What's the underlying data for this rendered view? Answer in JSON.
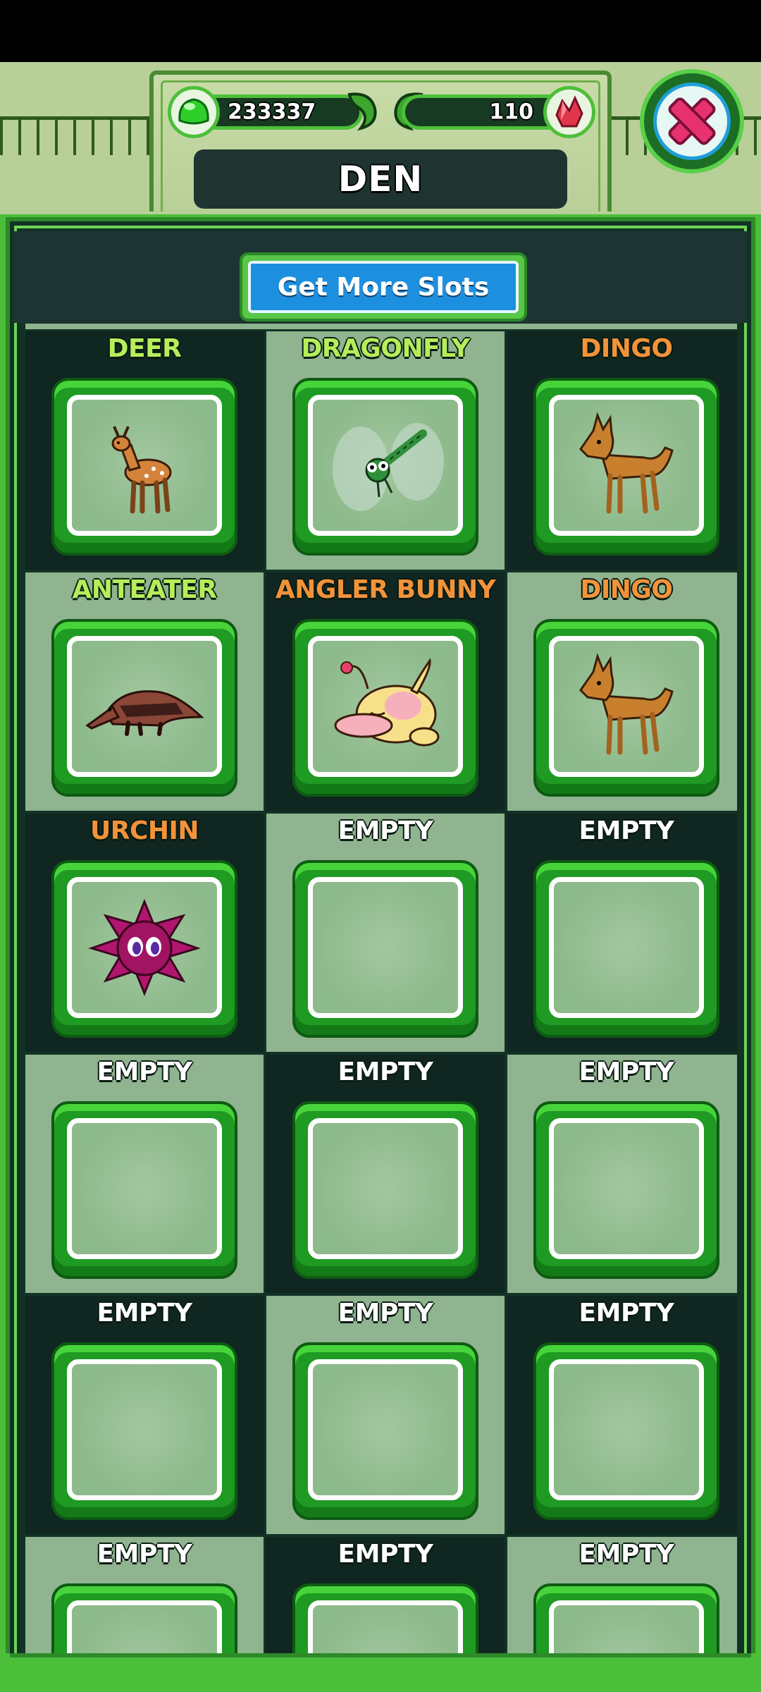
{
  "header": {
    "gel_count": "233337",
    "gem_count": "110",
    "title": "DEN"
  },
  "panel": {
    "more_slots_label": "Get More Slots"
  },
  "colors": {
    "name_green": "#b6ee5a",
    "name_orange": "#f2933a",
    "name_white": "#ffffff"
  },
  "slots": [
    {
      "name": "DEER",
      "color": "green",
      "creature": "deer-icon"
    },
    {
      "name": "DRAGONFLY",
      "color": "green",
      "creature": "dragonfly-icon"
    },
    {
      "name": "DINGO",
      "color": "orange",
      "creature": "dingo-icon"
    },
    {
      "name": "ANTEATER",
      "color": "green",
      "creature": "anteater-icon"
    },
    {
      "name": "ANGLER BUNNY",
      "color": "orange",
      "creature": "angler-bunny-icon"
    },
    {
      "name": "DINGO",
      "color": "orange",
      "creature": "dingo-icon"
    },
    {
      "name": "URCHIN",
      "color": "orange",
      "creature": "urchin-icon"
    },
    {
      "name": "EMPTY",
      "color": "white",
      "creature": ""
    },
    {
      "name": "EMPTY",
      "color": "white",
      "creature": ""
    },
    {
      "name": "EMPTY",
      "color": "white",
      "creature": ""
    },
    {
      "name": "EMPTY",
      "color": "white",
      "creature": ""
    },
    {
      "name": "EMPTY",
      "color": "white",
      "creature": ""
    },
    {
      "name": "EMPTY",
      "color": "white",
      "creature": ""
    },
    {
      "name": "EMPTY",
      "color": "white",
      "creature": ""
    },
    {
      "name": "EMPTY",
      "color": "white",
      "creature": ""
    },
    {
      "name": "EMPTY",
      "color": "white",
      "creature": ""
    },
    {
      "name": "EMPTY",
      "color": "white",
      "creature": ""
    },
    {
      "name": "EMPTY",
      "color": "white",
      "creature": ""
    }
  ]
}
